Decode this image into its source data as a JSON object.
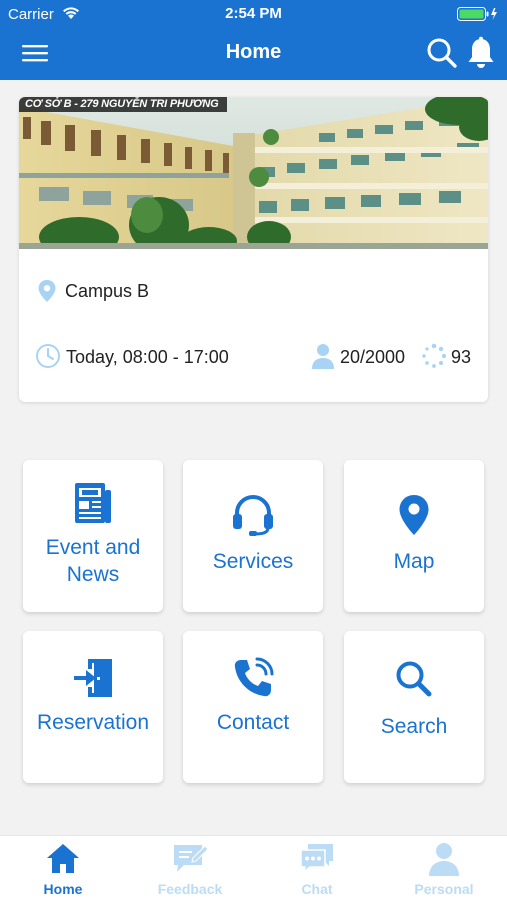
{
  "status_bar": {
    "carrier": "Carrier",
    "time": "2:54 PM"
  },
  "nav": {
    "title": "Home"
  },
  "campus": {
    "banner_caption": "CƠ SỞ B - 279 NGUYỄN TRI PHƯƠNG",
    "name": "Campus B",
    "hours": "Today, 08:00 - 17:00",
    "capacity": "20/2000",
    "count": "93"
  },
  "tiles": [
    {
      "line1": "Event and",
      "line2": "News",
      "icon": "newspaper-icon"
    },
    {
      "label": "Services",
      "icon": "headset-icon"
    },
    {
      "label": "Map",
      "icon": "map-pin-icon"
    },
    {
      "label": "Reservation",
      "icon": "door-enter-icon"
    },
    {
      "label": "Contact",
      "icon": "phone-ringing-icon"
    },
    {
      "label": "Search",
      "icon": "search-icon"
    }
  ],
  "tabbar": [
    {
      "label": "Home",
      "icon": "home-icon",
      "active": true
    },
    {
      "label": "Feedback",
      "icon": "feedback-icon",
      "active": false
    },
    {
      "label": "Chat",
      "icon": "chat-icon",
      "active": false
    },
    {
      "label": "Personal",
      "icon": "person-icon",
      "active": false
    }
  ],
  "colors": {
    "primary": "#1a73d0",
    "inactive_tab": "#bcdcf6",
    "background": "#f2f2f2",
    "icon_light": "#a9d3f5"
  }
}
